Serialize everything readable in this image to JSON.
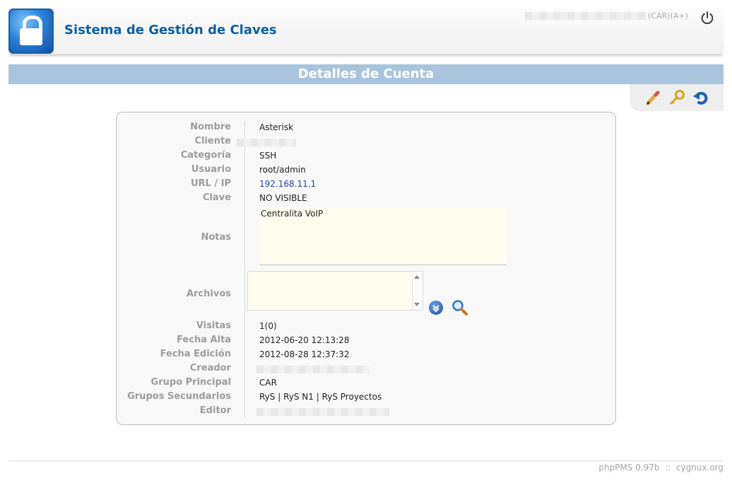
{
  "header": {
    "app_title": "Sistema de Gestión de Claves",
    "user_suffix": "(CAR)(A+)"
  },
  "page": {
    "title": "Detalles de Cuenta"
  },
  "actions": [
    "edit-icon",
    "key-icon",
    "back-icon"
  ],
  "details": {
    "labels": {
      "nombre": "Nombre",
      "cliente": "Cliente",
      "categoria": "Categoría",
      "usuario": "Usuario",
      "url": "URL / IP",
      "clave": "Clave",
      "notas": "Notas",
      "archivos": "Archivos",
      "visitas": "Visitas",
      "fecha_alta": "Fecha Alta",
      "fecha_edicion": "Fecha Edición",
      "creador": "Creador",
      "grupo_principal": "Grupo Principal",
      "grupos_secundarios": "Grupos Secundarios",
      "editor": "Editor"
    },
    "values": {
      "nombre": "Asterisk",
      "categoria": "SSH",
      "usuario": "root/admin",
      "url": "192.168.11.1",
      "clave": "NO VISIBLE",
      "notas": "Centralita VoIP",
      "visitas": "1(0)",
      "fecha_alta": "2012-06-20 12:13:28",
      "fecha_edicion": "2012-08-28 12:37:32",
      "grupo_principal": "CAR",
      "grupos_secundarios": "RyS | RyS N1 | RyS Proyectos"
    }
  },
  "footer": {
    "text": "phpPMS 0.97b  ::  cygnux.org"
  },
  "colors": {
    "brand_blue": "#0b5fa5",
    "title_bar": "#a9c4dc",
    "label_gray": "#9c9c9c",
    "link_blue": "#2a3f9a"
  }
}
